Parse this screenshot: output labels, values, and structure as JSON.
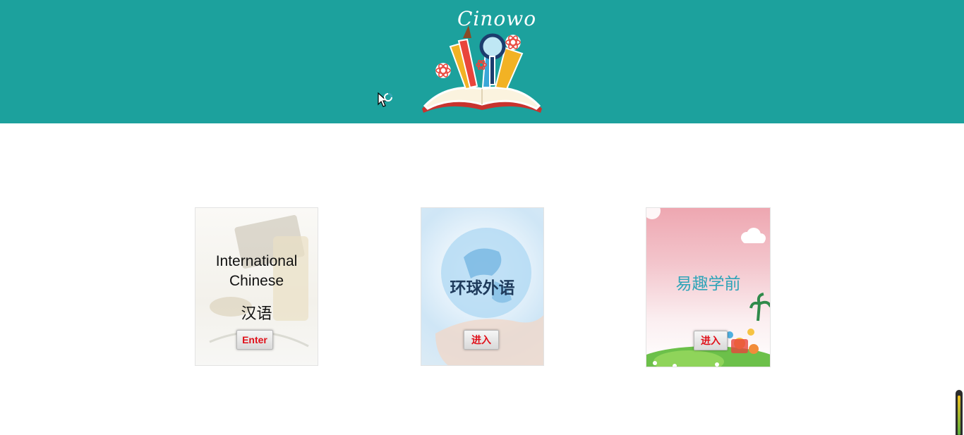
{
  "header": {
    "background": "#1ca19d",
    "logo_text": "Cinowo"
  },
  "cards": [
    {
      "title_en_line1": "International",
      "title_en_line2": "Chinese",
      "title_zh": "汉语",
      "button": "Enter"
    },
    {
      "title_zh": "环球外语",
      "button": "进入"
    },
    {
      "title_zh": "易趣学前",
      "button": "进入"
    }
  ],
  "colors": {
    "button_text": "#e0101a",
    "card2_title": "#1f3b5c",
    "card3_title": "#2fa4b8"
  }
}
